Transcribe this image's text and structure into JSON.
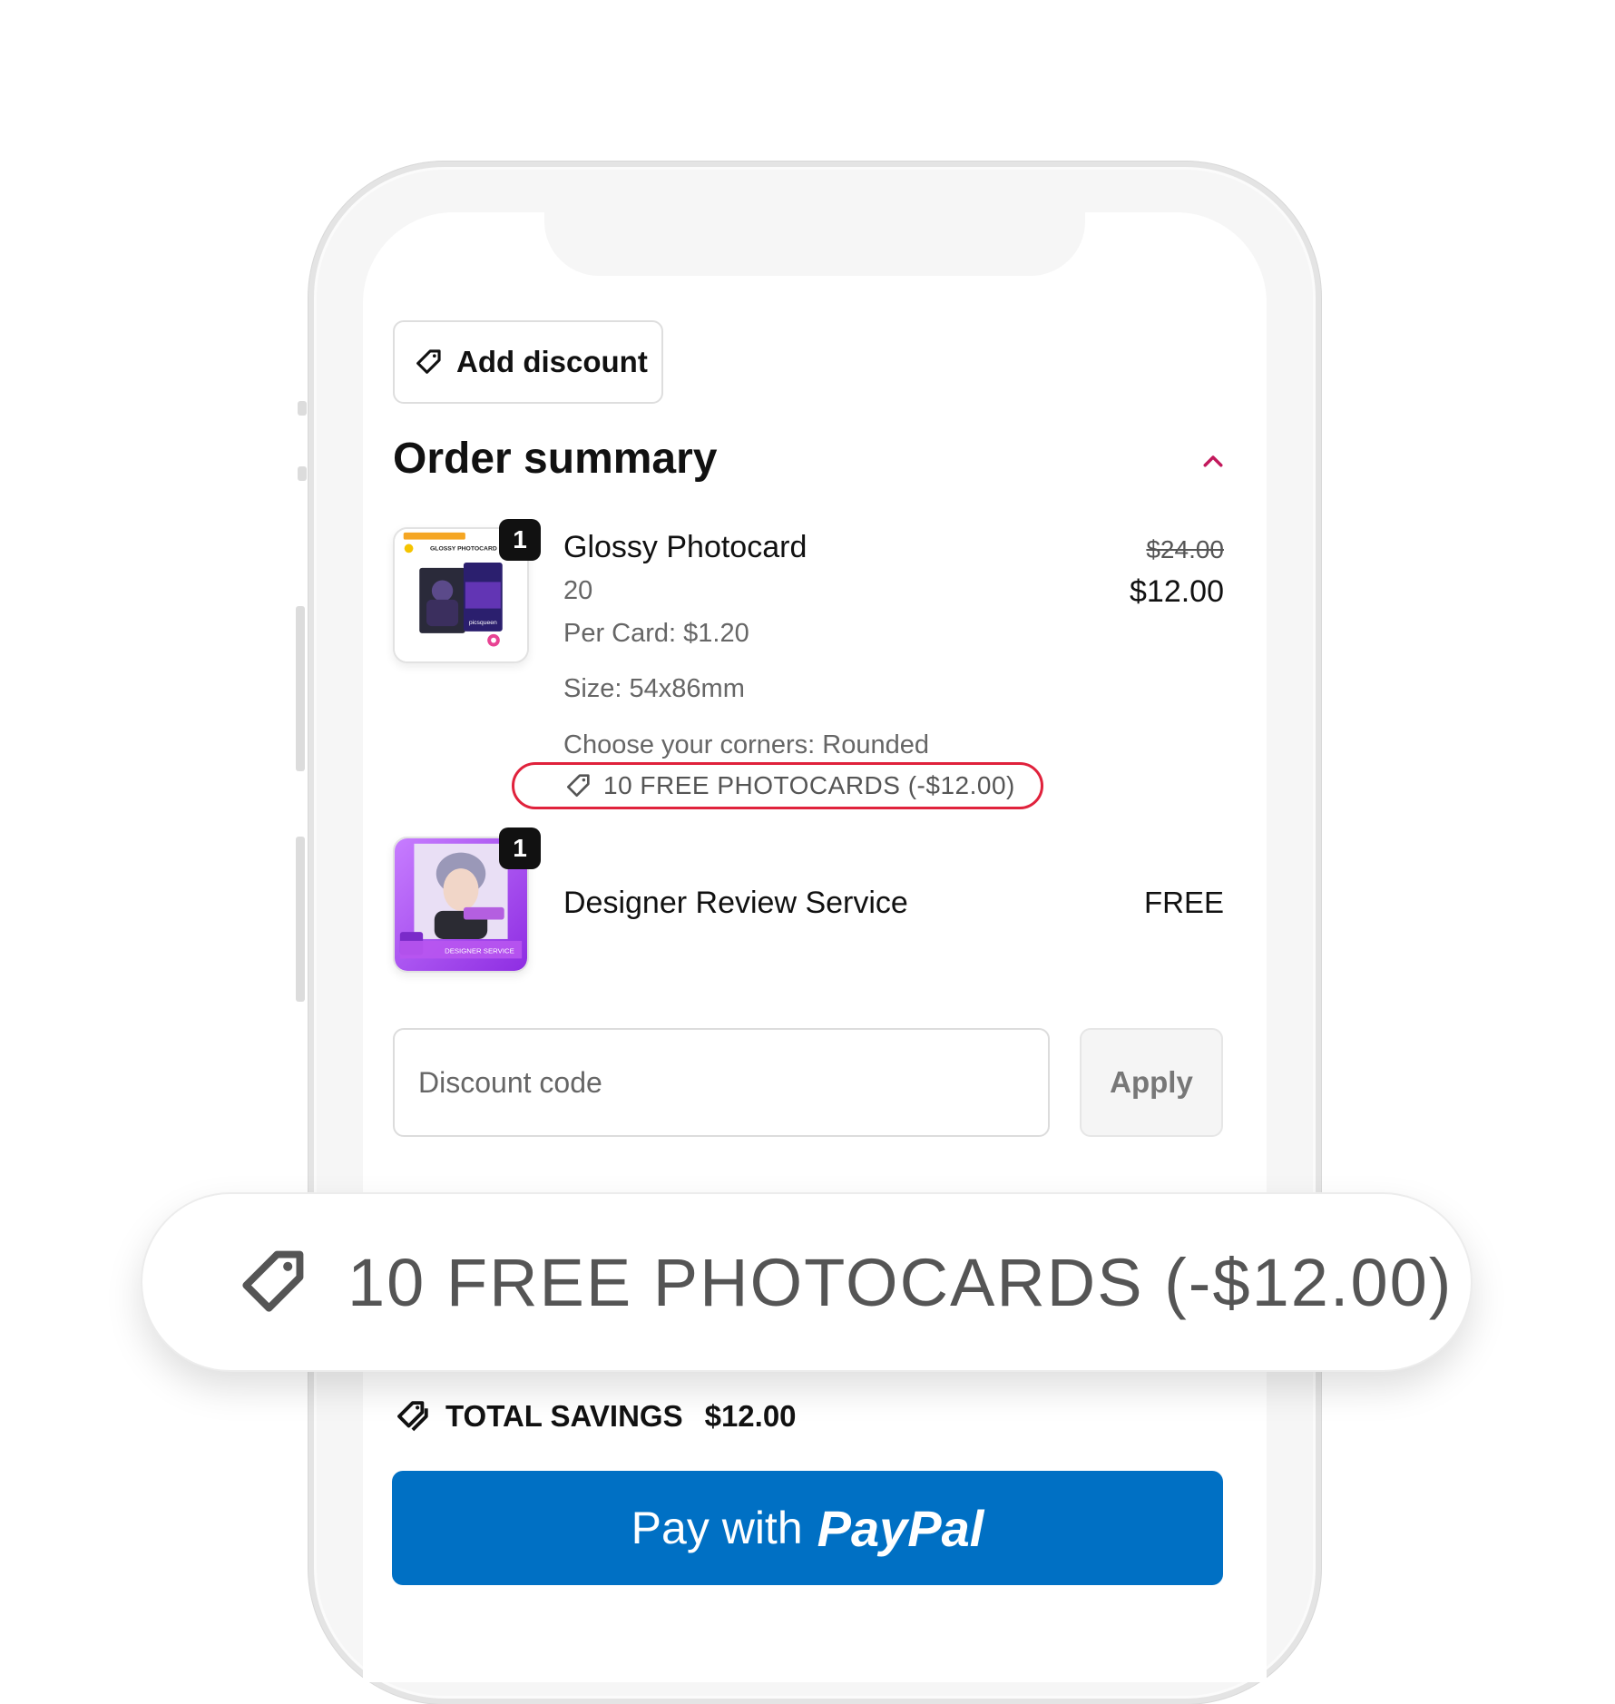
{
  "actions": {
    "add_discount_label": "Add discount"
  },
  "order_summary": {
    "title": "Order summary",
    "items": [
      {
        "thumb_texts": [
          "GLOSSY PHOTOCARD",
          "picsqueen"
        ],
        "quantity": "1",
        "name": "Glossy Photocard",
        "count": "20",
        "per_card": "Per Card: $1.20",
        "size": "Size: 54x86mm",
        "corners": "Choose your corners: Rounded",
        "discount_tag": "10 FREE PHOTOCARDS (-$12.00)",
        "price_original": "$24.00",
        "price_final": "$12.00"
      },
      {
        "thumb_texts": [
          "DESIGNER SERVICE"
        ],
        "quantity": "1",
        "name": "Designer Review Service",
        "price_final": "FREE"
      }
    ]
  },
  "discount_form": {
    "placeholder": "Discount code",
    "apply_label": "Apply"
  },
  "callout": {
    "text": "10 FREE PHOTOCARDS (-$12.00)"
  },
  "savings": {
    "label": "TOTAL SAVINGS",
    "amount": "$12.00"
  },
  "paypal": {
    "prefix": "Pay with",
    "brand": "PayPal",
    "color": "#0070c4"
  },
  "colors": {
    "highlight": "#e0223c",
    "chevron": "#c2185b"
  }
}
